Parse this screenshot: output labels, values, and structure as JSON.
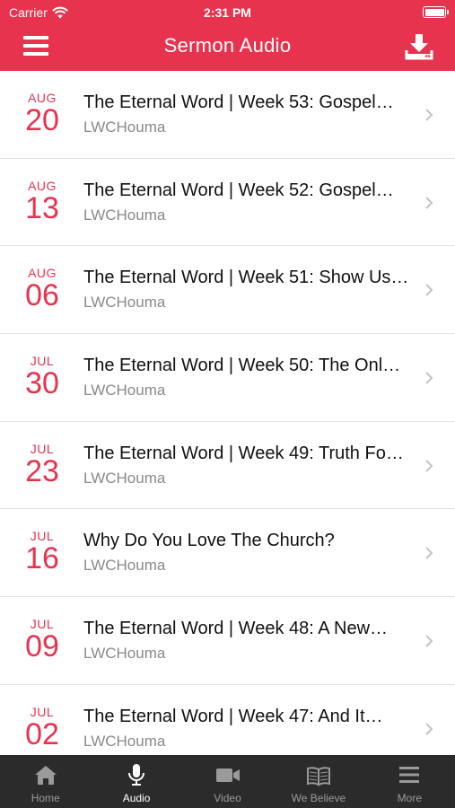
{
  "status_bar": {
    "carrier": "Carrier",
    "time": "2:31 PM"
  },
  "nav": {
    "title": "Sermon Audio",
    "menu_icon": "hamburger-icon",
    "download_icon": "download-icon"
  },
  "colors": {
    "accent": "#e8334f",
    "tabbar_bg": "#2b2b2b",
    "tab_active": "#ffffff",
    "tab_inactive": "#9a9a9a"
  },
  "sermons": [
    {
      "month": "AUG",
      "day": "20",
      "title": "The Eternal Word | Week 53: Gospel…",
      "author": "LWCHouma"
    },
    {
      "month": "AUG",
      "day": "13",
      "title": "The Eternal Word | Week 52: Gospel…",
      "author": "LWCHouma"
    },
    {
      "month": "AUG",
      "day": "06",
      "title": "The Eternal Word | Week 51: Show Us…",
      "author": "LWCHouma"
    },
    {
      "month": "JUL",
      "day": "30",
      "title": "The Eternal Word | Week 50: The Onl…",
      "author": "LWCHouma"
    },
    {
      "month": "JUL",
      "day": "23",
      "title": "The Eternal Word | Week 49: Truth Fo…",
      "author": "LWCHouma"
    },
    {
      "month": "JUL",
      "day": "16",
      "title": "Why Do You Love The Church?",
      "author": "LWCHouma"
    },
    {
      "month": "JUL",
      "day": "09",
      "title": "The Eternal Word | Week 48: A New…",
      "author": "LWCHouma"
    },
    {
      "month": "JUL",
      "day": "02",
      "title": "The Eternal Word | Week 47: And It…",
      "author": "LWCHouma"
    }
  ],
  "tabs": [
    {
      "label": "Home",
      "icon": "home-icon",
      "active": false
    },
    {
      "label": "Audio",
      "icon": "microphone-icon",
      "active": true
    },
    {
      "label": "Video",
      "icon": "video-camera-icon",
      "active": false
    },
    {
      "label": "We Believe",
      "icon": "book-icon",
      "active": false
    },
    {
      "label": "More",
      "icon": "more-menu-icon",
      "active": false
    }
  ]
}
